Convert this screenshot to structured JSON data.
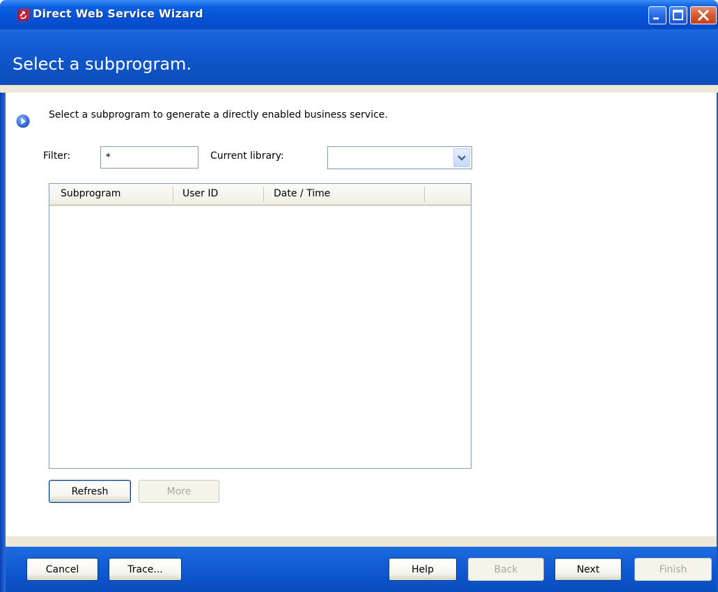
{
  "window": {
    "title": "Direct Web Service Wizard",
    "controls": [
      "minimize-icon",
      "maximize-icon",
      "close-icon"
    ]
  },
  "header": {
    "title": "Select a subprogram."
  },
  "intro": {
    "icon": "arrow-right-circle-icon",
    "text": "Select a subprogram to generate a directly enabled business service."
  },
  "filter": {
    "label": "Filter:",
    "value": "*"
  },
  "library": {
    "label": "Current library:",
    "value": ""
  },
  "table": {
    "columns": [
      "Subprogram",
      "User ID",
      "Date / Time"
    ],
    "rows": []
  },
  "list_buttons": {
    "refresh": "Refresh",
    "more": "More"
  },
  "footer": {
    "cancel": "Cancel",
    "trace": "Trace...",
    "help": "Help",
    "back": "Back",
    "next": "Next",
    "finish": "Finish"
  },
  "colors": {
    "title_blue": "#0653d6",
    "header_blue": "#1057cc",
    "separator_beige": "#ece9d8",
    "disabled_text": "#aca899"
  }
}
